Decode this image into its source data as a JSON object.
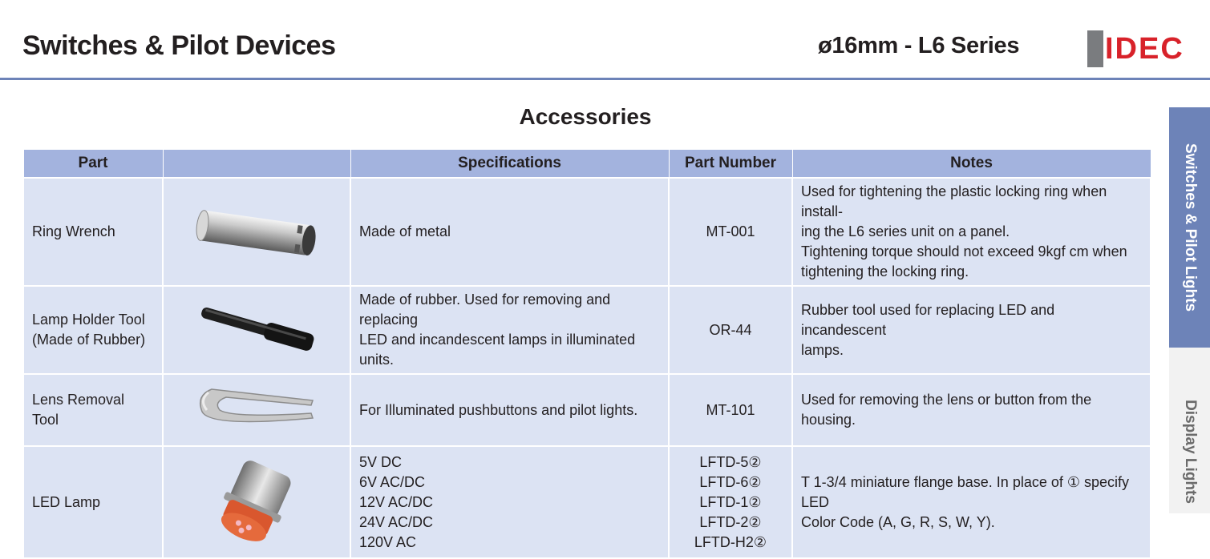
{
  "header": {
    "title": "Switches & Pilot Devices",
    "series": "ø16mm - L6 Series",
    "logo_text": "IDEC"
  },
  "heading": "Accessories",
  "table": {
    "columns": [
      "Part",
      "",
      "Specifications",
      "Part Number",
      "Notes"
    ],
    "rows": [
      {
        "part": "Ring Wrench",
        "image": "ring-wrench",
        "spec": [
          "Made of metal"
        ],
        "part_number": [
          "MT-001"
        ],
        "notes": [
          "Used for tightening the plastic locking ring when install-",
          "ing the L6 series unit on a panel.",
          "Tightening torque should not exceed 9kgf cm when",
          "tightening the locking ring."
        ]
      },
      {
        "part": [
          "Lamp Holder Tool",
          "(Made of Rubber)"
        ],
        "image": "lamp-holder-tool",
        "spec": [
          "Made of rubber. Used for removing and replacing",
          "LED and incandescent lamps in illuminated units."
        ],
        "part_number": [
          "OR-44"
        ],
        "notes": [
          "Rubber tool used for replacing LED and incandescent",
          "lamps."
        ]
      },
      {
        "part": "Lens Removal Tool",
        "image": "lens-removal-tool",
        "spec": [
          "For Illuminated pushbuttons and pilot lights."
        ],
        "part_number": [
          "MT-101"
        ],
        "notes": [
          "Used for removing the lens or button from the housing."
        ]
      },
      {
        "part": "LED Lamp",
        "image": "led-lamp",
        "spec": [
          "5V DC",
          "6V AC/DC",
          "12V AC/DC",
          "24V AC/DC",
          "120V AC"
        ],
        "part_number": [
          "LFTD-5②",
          "LFTD-6②",
          "LFTD-1②",
          "LFTD-2②",
          "LFTD-H2②"
        ],
        "notes": [
          "T 1-3/4 miniature flange base. In place of ① specify LED",
          "Color Code (A, G, R, S, W, Y)."
        ]
      }
    ]
  },
  "side_tabs": [
    "Switches & Pilot Lights",
    "Display Lights"
  ],
  "colors": {
    "accent": "#6d83b8",
    "header_row": "#a3b3de",
    "row_bg": "#dce3f3",
    "logo_red": "#d8222a"
  }
}
